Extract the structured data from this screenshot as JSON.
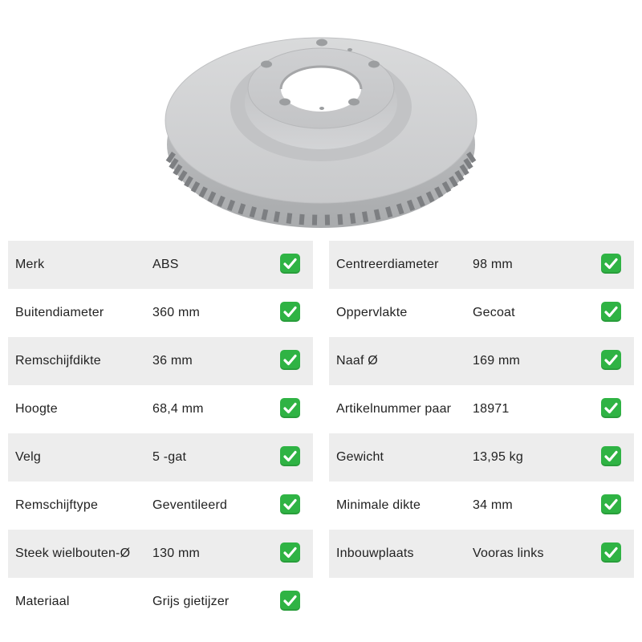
{
  "product_image": {
    "alt": "brake-disc"
  },
  "colors": {
    "row_shade": "#ededed",
    "check_green": "#2fb344",
    "text": "#222222"
  },
  "check_icon": "green-check-mark-icon",
  "left_specs": [
    {
      "label": "Merk",
      "value": "ABS",
      "verified": true
    },
    {
      "label": "Buitendiameter",
      "value": "360 mm",
      "verified": true
    },
    {
      "label": "Remschijfdikte",
      "value": "36 mm",
      "verified": true
    },
    {
      "label": "Hoogte",
      "value": "68,4 mm",
      "verified": true
    },
    {
      "label": "Velg",
      "value": "5 -gat",
      "verified": true
    },
    {
      "label": "Remschijftype",
      "value": "Geventileerd",
      "verified": true
    },
    {
      "label": "Steek wielbouten-Ø",
      "value": "130 mm",
      "verified": true
    },
    {
      "label": "Materiaal",
      "value": "Grijs gietijzer",
      "verified": true
    }
  ],
  "right_specs": [
    {
      "label": "Centreerdiameter",
      "value": "98 mm",
      "verified": true
    },
    {
      "label": "Oppervlakte",
      "value": "Gecoat",
      "verified": true
    },
    {
      "label": "Naaf Ø",
      "value": "169 mm",
      "verified": true
    },
    {
      "label": "Artikelnummer paar",
      "value": "18971",
      "verified": true
    },
    {
      "label": "Gewicht",
      "value": "13,95 kg",
      "verified": true
    },
    {
      "label": "Minimale dikte",
      "value": "34 mm",
      "verified": true
    },
    {
      "label": "Inbouwplaats",
      "value": "Vooras links",
      "verified": true
    }
  ]
}
